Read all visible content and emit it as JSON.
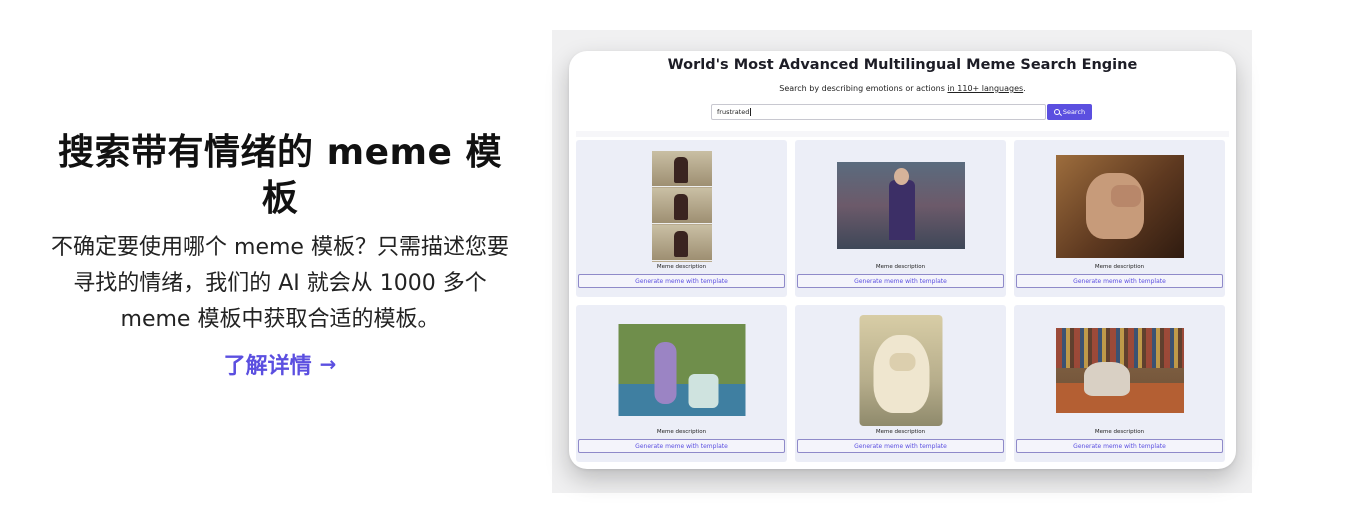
{
  "left": {
    "title": "搜索带有情绪的 meme 模板",
    "description": "不确定要使用哪个 meme 模板？只需描述您要寻找的情绪，我们的 AI 就会从 1000 多个 meme 模板中获取合适的模板。",
    "link_label": "了解详情",
    "link_arrow": "→",
    "accent_color": "#5b4fe0"
  },
  "app": {
    "title": "World's Most Advanced Multilingual Meme Search Engine",
    "subtitle_prefix": "Search by describing emotions or actions ",
    "subtitle_link": "in 110+ languages",
    "subtitle_suffix": ".",
    "search": {
      "value": "frustrated",
      "button_label": "Search",
      "button_icon": "search-icon"
    },
    "results": [
      {
        "desc": "Meme description",
        "button": "Generate meme with template"
      },
      {
        "desc": "Meme description",
        "button": "Generate meme with template"
      },
      {
        "desc": "Meme description",
        "button": "Generate meme with template"
      },
      {
        "desc": "Meme description",
        "button": "Generate meme with template"
      },
      {
        "desc": "Meme description",
        "button": "Generate meme with template"
      },
      {
        "desc": "Meme description",
        "button": "Generate meme with template"
      }
    ]
  }
}
